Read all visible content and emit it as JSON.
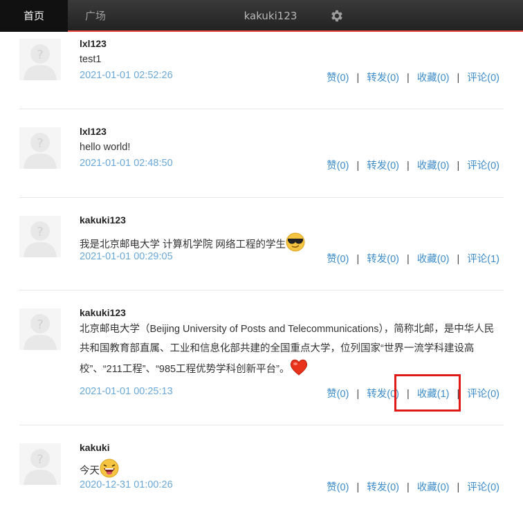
{
  "nav": {
    "home": "首页",
    "square": "广场",
    "username": "kakuki123",
    "settings_icon": "gear-icon"
  },
  "posts": [
    {
      "user": "lxl123",
      "content": "test1",
      "time": "2021-01-01 02:52:26",
      "like": "赞(0)",
      "repost": "转发(0)",
      "fav": "收藏(0)",
      "comment": "评论(0)"
    },
    {
      "user": "lxl123",
      "content": "hello world!",
      "time": "2021-01-01 02:48:50",
      "like": "赞(0)",
      "repost": "转发(0)",
      "fav": "收藏(0)",
      "comment": "评论(0)"
    },
    {
      "user": "kakuki123",
      "content": "我是北京邮电大学 计算机学院 网络工程的学生",
      "emoji": "sunglasses-emoji",
      "time": "2021-01-01 00:29:05",
      "like": "赞(0)",
      "repost": "转发(0)",
      "fav": "收藏(0)",
      "comment": "评论(1)"
    },
    {
      "user": "kakuki123",
      "content": "北京邮电大学（Beijing University of Posts and Telecommunications），简称北邮，是中华人民共和国教育部直属、工业和信息化部共建的全国重点大学，位列国家“世界一流学科建设高校”、“211工程”、“985工程优势学科创新平台”。",
      "emoji": "heart-emoji",
      "time": "2021-01-01 00:25:13",
      "like": "赞(0)",
      "repost": "转发(0)",
      "fav": "收藏(1)",
      "comment": "评论(0)"
    },
    {
      "user": "kakuki",
      "content": "今天",
      "emoji": "laughing-emoji",
      "time": "2020-12-31 01:00:26",
      "like": "赞(0)",
      "repost": "转发(0)",
      "fav": "收藏(0)",
      "comment": "评论(0)"
    }
  ],
  "colors": {
    "accent": "#e8453c",
    "link": "#3d8ccb",
    "time": "#6aa8d8",
    "highlight": "#e01919"
  }
}
